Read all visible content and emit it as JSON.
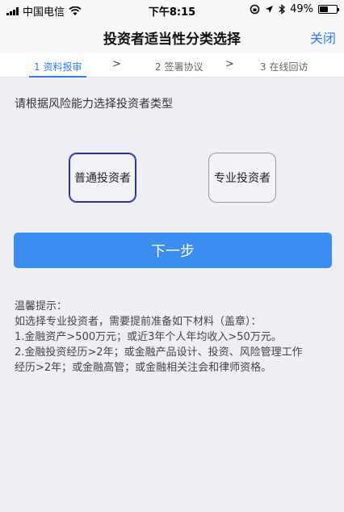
{
  "status": {
    "carrier": "中国电信",
    "time": "下午8:15",
    "battery": "49%",
    "battery_level": 0.49
  },
  "nav": {
    "title": "投资者适当性分类选择",
    "close_label": "关闭"
  },
  "steps": [
    {
      "label": "1 资料报审",
      "active": true
    },
    {
      "label": "2 签署协议",
      "active": false
    },
    {
      "label": "3 在线回访",
      "active": false
    }
  ],
  "step_arrow": ">",
  "prompt": "请根据风险能力选择投资者类型",
  "choices": {
    "ordinary": "普通投资者",
    "professional": "专业投资者"
  },
  "next_label": "下一步",
  "tips": {
    "lines": [
      "温馨提示：",
      "如选择专业投资者，需要提前准备如下材料（盖章）：",
      "1.金融资产>500万元；或近3年个人年均收入>50万元。",
      "2.金融投资经历>2年；或金融产品设计、投资、风险管理工作",
      "经历>2年；或金融高管；或金融相关注会和律师资格。"
    ]
  }
}
